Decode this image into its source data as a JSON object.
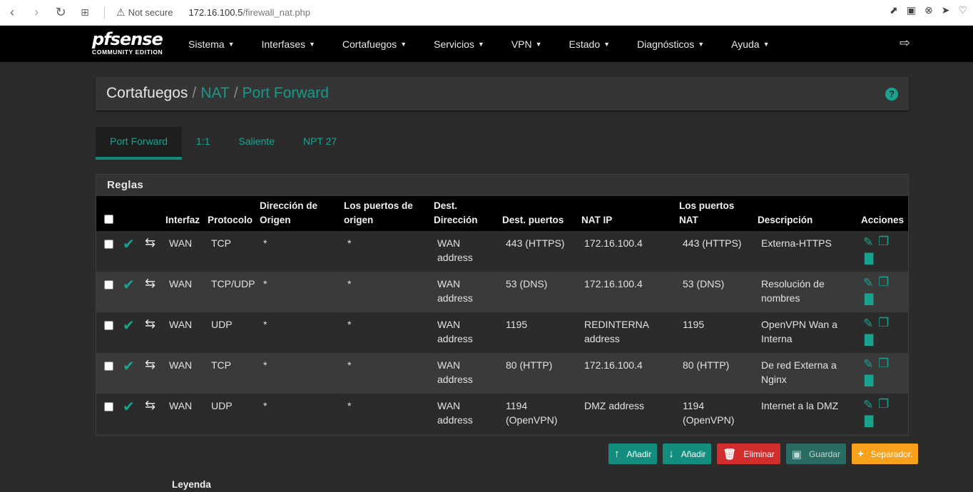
{
  "browser": {
    "not_secure": "Not secure",
    "url_host": "172.16.100.5",
    "url_path": "/firewall_nat.php"
  },
  "brand": {
    "name": "pfsense",
    "edition": "COMMUNITY EDITION"
  },
  "menu": [
    "Sistema",
    "Interfases",
    "Cortafuegos",
    "Servicios",
    "VPN",
    "Estado",
    "Diagnósticos",
    "Ayuda"
  ],
  "breadcrumb": {
    "root": "Cortafuegos",
    "level2": "NAT",
    "level3": "Port Forward"
  },
  "tabs": [
    "Port Forward",
    "1:1",
    "Saliente",
    "NPT 27"
  ],
  "panel": {
    "title": "Reglas"
  },
  "table": {
    "headers": {
      "interfaz": "Interfaz",
      "protocolo": "Protocolo",
      "origen1": "Dirección de",
      "origen2": "Origen",
      "puertos_origen1": "Los puertos de",
      "puertos_origen2": "origen",
      "dest1": "Dest.",
      "dest2": "Dirección",
      "dest_puertos": "Dest. puertos",
      "nat_ip": "NAT IP",
      "nat_puertos1": "Los puertos",
      "nat_puertos2": "NAT",
      "descripcion": "Descripción",
      "acciones": "Acciones"
    },
    "rows": [
      {
        "iface": "WAN",
        "proto": "TCP",
        "src": "*",
        "src_ports": "*",
        "dest1": "WAN",
        "dest2": "address",
        "dest_ports1": "443 (HTTPS)",
        "dest_ports2": "",
        "nat_ip1": "172.16.100.4",
        "nat_ip2": "",
        "nat_ports1": "443 (HTTPS)",
        "nat_ports2": "",
        "desc1": "Externa-HTTPS",
        "desc2": ""
      },
      {
        "iface": "WAN",
        "proto": "TCP/UDP",
        "src": "*",
        "src_ports": "*",
        "dest1": "WAN",
        "dest2": "address",
        "dest_ports1": "53 (DNS)",
        "dest_ports2": "",
        "nat_ip1": "172.16.100.4",
        "nat_ip2": "",
        "nat_ports1": "53 (DNS)",
        "nat_ports2": "",
        "desc1": "Resolución de",
        "desc2": "nombres"
      },
      {
        "iface": "WAN",
        "proto": "UDP",
        "src": "*",
        "src_ports": "*",
        "dest1": "WAN",
        "dest2": "address",
        "dest_ports1": "1195",
        "dest_ports2": "",
        "nat_ip1": "REDINTERNA",
        "nat_ip2": "address",
        "nat_ports1": "1195",
        "nat_ports2": "",
        "desc1": "OpenVPN Wan a",
        "desc2": "Interna"
      },
      {
        "iface": "WAN",
        "proto": "TCP",
        "src": "*",
        "src_ports": "*",
        "dest1": "WAN",
        "dest2": "address",
        "dest_ports1": "80 (HTTP)",
        "dest_ports2": "",
        "nat_ip1": "172.16.100.4",
        "nat_ip2": "",
        "nat_ports1": "80 (HTTP)",
        "nat_ports2": "",
        "desc1": "De red Externa a",
        "desc2": "Nginx"
      },
      {
        "iface": "WAN",
        "proto": "UDP",
        "src": "*",
        "src_ports": "*",
        "dest1": "WAN",
        "dest2": "address",
        "dest_ports1": "1194",
        "dest_ports2": "(OpenVPN)",
        "nat_ip1": "DMZ address",
        "nat_ip2": "",
        "nat_ports1": "1194",
        "nat_ports2": "(OpenVPN)",
        "desc1": "Internet a la DMZ",
        "desc2": ""
      }
    ]
  },
  "buttons": {
    "add_top": "Añadir",
    "add_bottom": "Añadir",
    "delete": "Eliminar",
    "save": "Guardar",
    "separator": "Separador."
  },
  "legend": "Leyenda",
  "colors": {
    "accent": "#19a38f",
    "navbar": "#000000",
    "background": "#2b2b2b",
    "danger": "#d12d2d",
    "warning": "#f8a11c"
  }
}
